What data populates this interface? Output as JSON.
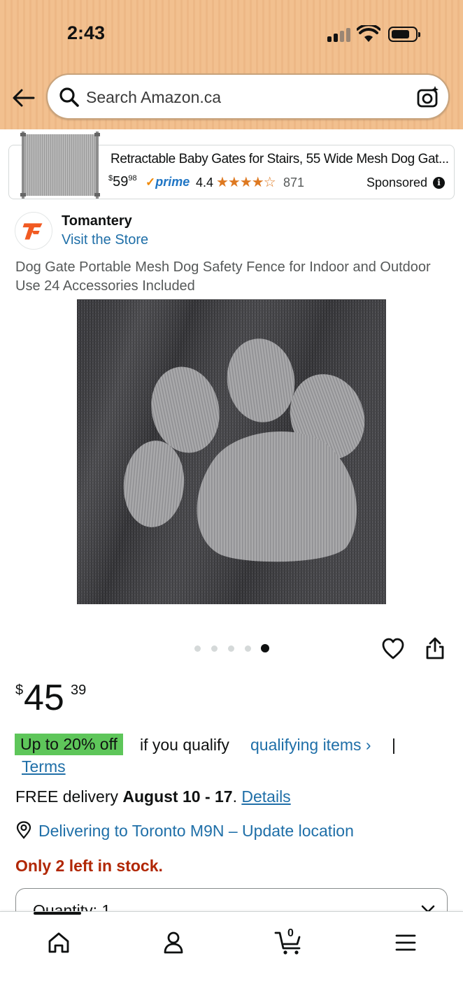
{
  "status_bar": {
    "time": "2:43"
  },
  "search": {
    "placeholder": "Search Amazon.ca"
  },
  "sponsored_ad": {
    "title": "Retractable Baby Gates for Stairs, 55 Wide Mesh Dog Gat...",
    "price_symbol": "$",
    "price_whole": "59",
    "price_fraction": "98",
    "prime_check": "✓",
    "prime_label": "prime",
    "rating": "4.4",
    "stars": "★★★★☆",
    "rating_value": 4.4,
    "review_count": "871",
    "sponsored_label": "Sponsored",
    "info_glyph": "i"
  },
  "store": {
    "name": "Tomantery",
    "link": "Visit the Store"
  },
  "product": {
    "title": "Dog Gate Portable Mesh Dog Safety Fence for Indoor and Outdoor Use 24 Accessories Included",
    "image_count": 5,
    "active_image_index": 4
  },
  "price": {
    "symbol": "$",
    "whole": "45",
    "fraction": "39"
  },
  "promo": {
    "badge": "Up to 20% off",
    "text": "if you qualify",
    "link": "qualifying items ›",
    "separator": "|",
    "terms": "Terms"
  },
  "delivery": {
    "prefix": "FREE delivery ",
    "dates": "August 10 - 17",
    "suffix": ". ",
    "details_link": "Details"
  },
  "location": {
    "text": "Delivering to Toronto M9N – Update location"
  },
  "stock": {
    "text": "Only 2 left in stock."
  },
  "quantity": {
    "label": "Quantity: 1"
  },
  "cart": {
    "count": "0"
  },
  "colors": {
    "header_bg": "#f2c08f",
    "link": "#1f6fa8",
    "promo_green": "#5ec65a",
    "stock_red": "#b12704",
    "star_orange": "#de7921",
    "prime_blue": "#1f75c4"
  },
  "icons": {
    "back": "back-arrow-icon",
    "search": "search-icon",
    "camera": "camera-icon",
    "heart": "heart-icon",
    "share": "share-icon",
    "location": "location-pin-icon",
    "home": "home-icon",
    "profile": "profile-icon",
    "cart": "cart-icon",
    "menu": "menu-icon"
  }
}
